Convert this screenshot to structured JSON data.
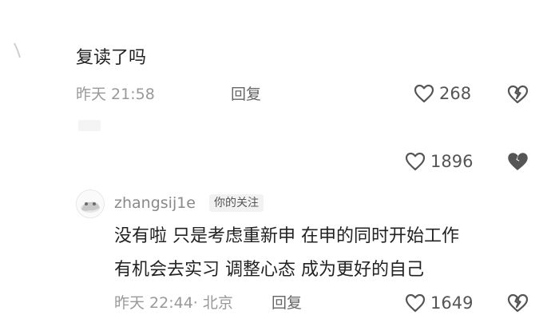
{
  "comments": [
    {
      "text": "复读了吗",
      "meta": "昨天 21:58",
      "reply_label": "回复",
      "likes": "268"
    },
    {
      "likes": "1896"
    },
    {
      "username": "zhangsij1e",
      "tag": "你的关注",
      "line1": "没有啦 只是考虑重新申 在申的同时开始工作",
      "line2": "有机会去实习 调整心态 成为更好的自己",
      "meta": "昨天 22:44· 北京",
      "reply_label": "回复",
      "likes": "1649"
    }
  ],
  "colors": {
    "text": "#222222",
    "meta": "#999999",
    "icon": "#555555"
  },
  "icons": [
    "heart-outline-icon",
    "broken-heart-icon",
    "avatar"
  ]
}
